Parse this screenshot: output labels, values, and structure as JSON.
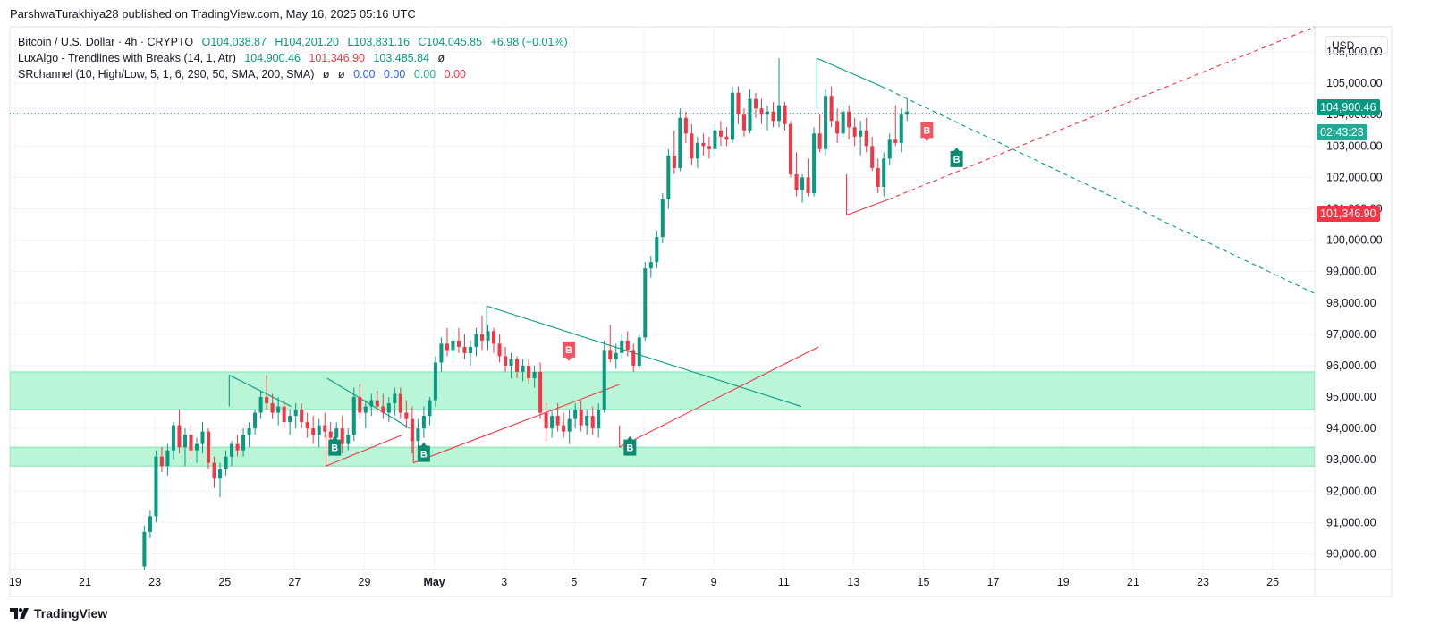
{
  "publish_line": "ParshwaTurakhiya28 published on TradingView.com, May 16, 2025 05:16 UTC",
  "legend": {
    "main": {
      "title": "Bitcoin / U.S. Dollar · 4h · CRYPTO",
      "open": "O104,038.87",
      "high": "H104,201.20",
      "low": "L103,831.16",
      "close": "C104,045.85",
      "change": "+6.98 (+0.01%)"
    },
    "luxalgo": {
      "name": "LuxAlgo - Trendlines with Breaks (14, 1, Atr)",
      "v1": "104,900.46",
      "v2": "101,346.90",
      "v3": "103,485.84",
      "v4": "ø"
    },
    "srchannel": {
      "name": "SRchannel (10, High/Low, 5, 1, 6, 290, 50, SMA, 200, SMA)",
      "v1": "ø",
      "v2": "ø",
      "v3": "0.00",
      "v4": "0.00",
      "v5": "0.00",
      "v6": "0.00"
    }
  },
  "currency": "USD",
  "brand": "TradingView",
  "price_tags": {
    "upper": "104,900.46",
    "countdown": "02:43:23",
    "lower": "101,346.90"
  },
  "colors": {
    "up": "#089981",
    "down": "#f23645",
    "zone": "#b9f6d7",
    "zone_border": "#7be3ad",
    "upper_trend": "#089981",
    "lower_trend": "#f23645"
  },
  "chart_data": {
    "type": "candlestick",
    "title": "Bitcoin / U.S. Dollar · 4h · CRYPTO",
    "ylim": [
      89500,
      106800
    ],
    "y_ticks": [
      "90,000.00",
      "91,000.00",
      "92,000.00",
      "93,000.00",
      "94,000.00",
      "95,000.00",
      "96,000.00",
      "97,000.00",
      "98,000.00",
      "99,000.00",
      "100,000.00",
      "101,000.00",
      "102,000.00",
      "103,000.00",
      "104,000.00",
      "105,000.00",
      "106,000.00"
    ],
    "y_tick_values": [
      90000,
      91000,
      92000,
      93000,
      94000,
      95000,
      96000,
      97000,
      98000,
      99000,
      100000,
      101000,
      102000,
      103000,
      104000,
      105000,
      106000
    ],
    "x_ticks": [
      "19",
      "21",
      "23",
      "25",
      "27",
      "29",
      "May",
      "3",
      "5",
      "7",
      "9",
      "11",
      "13",
      "15",
      "17",
      "19",
      "21",
      "23",
      "25"
    ],
    "x_tick_day_index": [
      0,
      2,
      4,
      6,
      8,
      10,
      12,
      14,
      16,
      18,
      20,
      22,
      24,
      26,
      28,
      30,
      32,
      34,
      36
    ],
    "x_domain_days": [
      -0.15,
      37.2
    ],
    "candle_start_day": 3.7,
    "candles_per_day": 6,
    "candles": [
      [
        89600,
        90900,
        89500,
        90700
      ],
      [
        90700,
        91400,
        90500,
        91200
      ],
      [
        91200,
        93300,
        91000,
        93100
      ],
      [
        93100,
        93400,
        92600,
        92800
      ],
      [
        92800,
        93500,
        92500,
        93300
      ],
      [
        93300,
        94200,
        93000,
        94100
      ],
      [
        94100,
        94600,
        93200,
        93400
      ],
      [
        93400,
        94000,
        92800,
        93800
      ],
      [
        93800,
        94100,
        93000,
        93300
      ],
      [
        93300,
        93700,
        92900,
        93500
      ],
      [
        93500,
        94200,
        93200,
        93900
      ],
      [
        93900,
        94000,
        92700,
        92900
      ],
      [
        92900,
        93100,
        92100,
        92400
      ],
      [
        92400,
        92900,
        91800,
        92700
      ],
      [
        92700,
        93300,
        92500,
        93100
      ],
      [
        93100,
        93600,
        92800,
        93500
      ],
      [
        93500,
        93800,
        93100,
        93300
      ],
      [
        93300,
        94000,
        93100,
        93800
      ],
      [
        93800,
        94200,
        93400,
        94000
      ],
      [
        94000,
        94600,
        93800,
        94500
      ],
      [
        94500,
        95200,
        94300,
        95000
      ],
      [
        95000,
        95700,
        94600,
        94800
      ],
      [
        94800,
        95100,
        94300,
        94500
      ],
      [
        94500,
        95000,
        94100,
        94700
      ],
      [
        94700,
        94900,
        94000,
        94200
      ],
      [
        94200,
        94600,
        93800,
        94400
      ],
      [
        94400,
        94800,
        94000,
        94600
      ],
      [
        94600,
        94800,
        94000,
        94200
      ],
      [
        94200,
        94500,
        93700,
        94000
      ],
      [
        94000,
        94400,
        93500,
        93800
      ],
      [
        93800,
        94300,
        93400,
        94100
      ],
      [
        94100,
        94500,
        93700,
        93900
      ],
      [
        93900,
        94200,
        93300,
        93700
      ],
      [
        93700,
        94200,
        93400,
        94000
      ],
      [
        94000,
        94400,
        93200,
        93500
      ],
      [
        93500,
        94000,
        93300,
        93800
      ],
      [
        93800,
        95300,
        93600,
        95000
      ],
      [
        95000,
        95400,
        94300,
        94500
      ],
      [
        94500,
        94900,
        94000,
        94700
      ],
      [
        94700,
        95100,
        94400,
        94900
      ],
      [
        94900,
        95200,
        94500,
        94700
      ],
      [
        94700,
        95100,
        94300,
        94500
      ],
      [
        94500,
        95000,
        94200,
        94800
      ],
      [
        94800,
        95300,
        94400,
        95100
      ],
      [
        95100,
        95300,
        94300,
        94500
      ],
      [
        94500,
        94900,
        94000,
        94300
      ],
      [
        94300,
        94700,
        93200,
        93600
      ],
      [
        93600,
        94300,
        93400,
        94000
      ],
      [
        94000,
        94700,
        93700,
        94400
      ],
      [
        94400,
        95000,
        94100,
        94900
      ],
      [
        94900,
        96300,
        94700,
        96100
      ],
      [
        96100,
        96900,
        95800,
        96700
      ],
      [
        96700,
        97200,
        96300,
        96500
      ],
      [
        96500,
        97000,
        96200,
        96800
      ],
      [
        96800,
        97200,
        96400,
        96600
      ],
      [
        96600,
        97000,
        96200,
        96400
      ],
      [
        96400,
        96800,
        96000,
        96600
      ],
      [
        96600,
        97200,
        96300,
        97000
      ],
      [
        97000,
        97600,
        96500,
        96800
      ],
      [
        96800,
        97300,
        96500,
        97100
      ],
      [
        97100,
        97200,
        96400,
        96700
      ],
      [
        96700,
        97000,
        96100,
        96300
      ],
      [
        96300,
        96600,
        95800,
        96000
      ],
      [
        96000,
        96400,
        95600,
        96200
      ],
      [
        96200,
        96300,
        95600,
        95800
      ],
      [
        95800,
        96200,
        95500,
        96000
      ],
      [
        96000,
        96200,
        95400,
        95600
      ],
      [
        95600,
        96000,
        95300,
        95800
      ],
      [
        95800,
        96100,
        94300,
        94500
      ],
      [
        94500,
        94800,
        93600,
        94000
      ],
      [
        94000,
        94600,
        93700,
        94400
      ],
      [
        94400,
        94800,
        93900,
        94100
      ],
      [
        94100,
        94500,
        93700,
        93900
      ],
      [
        93900,
        94600,
        93500,
        94300
      ],
      [
        94300,
        94800,
        94000,
        94600
      ],
      [
        94600,
        94900,
        93900,
        94100
      ],
      [
        94100,
        94600,
        93800,
        94400
      ],
      [
        94400,
        94700,
        93800,
        94000
      ],
      [
        94000,
        94800,
        93700,
        94600
      ],
      [
        94600,
        96800,
        94500,
        96500
      ],
      [
        96500,
        97300,
        96100,
        96200
      ],
      [
        96200,
        96700,
        95900,
        96400
      ],
      [
        96400,
        97000,
        96200,
        96800
      ],
      [
        96800,
        97100,
        96300,
        96500
      ],
      [
        96500,
        96700,
        95800,
        96000
      ],
      [
        96000,
        97000,
        95900,
        96900
      ],
      [
        96900,
        99300,
        96800,
        99100
      ],
      [
        99100,
        99500,
        98800,
        99300
      ],
      [
        99300,
        100300,
        99100,
        100100
      ],
      [
        100100,
        101500,
        99900,
        101300
      ],
      [
        101300,
        102900,
        101000,
        102700
      ],
      [
        102700,
        103500,
        102100,
        102300
      ],
      [
        102300,
        104200,
        102200,
        103900
      ],
      [
        103900,
        104100,
        103100,
        103400
      ],
      [
        103400,
        103700,
        102400,
        102600
      ],
      [
        102600,
        103300,
        102300,
        103100
      ],
      [
        103100,
        103400,
        102700,
        103000
      ],
      [
        103000,
        103300,
        102600,
        102900
      ],
      [
        102900,
        103700,
        102700,
        103500
      ],
      [
        103500,
        103800,
        103000,
        103300
      ],
      [
        103300,
        103600,
        103000,
        103200
      ],
      [
        103200,
        104900,
        103100,
        104700
      ],
      [
        104700,
        104900,
        103700,
        104000
      ],
      [
        104000,
        104200,
        103300,
        103500
      ],
      [
        103500,
        104800,
        103400,
        104500
      ],
      [
        104500,
        104700,
        103900,
        104200
      ],
      [
        104200,
        104500,
        103700,
        104000
      ],
      [
        104000,
        104300,
        103500,
        104100
      ],
      [
        104100,
        104400,
        103600,
        103800
      ],
      [
        103800,
        105800,
        103600,
        104300
      ],
      [
        104300,
        104400,
        103500,
        103700
      ],
      [
        103700,
        103800,
        102000,
        102100
      ],
      [
        102100,
        102800,
        101400,
        101600
      ],
      [
        101600,
        102100,
        101200,
        102000
      ],
      [
        102000,
        102600,
        101400,
        101500
      ],
      [
        101500,
        103600,
        101400,
        103400
      ],
      [
        103400,
        104000,
        102800,
        102900
      ],
      [
        102900,
        104800,
        102700,
        104600
      ],
      [
        104600,
        104900,
        103600,
        103800
      ],
      [
        103800,
        104200,
        103100,
        103400
      ],
      [
        103400,
        104300,
        103300,
        104100
      ],
      [
        104100,
        104300,
        103200,
        103600
      ],
      [
        103600,
        103900,
        103000,
        103300
      ],
      [
        103300,
        103800,
        102700,
        103500
      ],
      [
        103500,
        103900,
        102800,
        103000
      ],
      [
        103000,
        103300,
        102200,
        102300
      ],
      [
        102300,
        102600,
        101500,
        101700
      ],
      [
        101700,
        102800,
        101400,
        102600
      ],
      [
        102600,
        103400,
        102400,
        103200
      ],
      [
        103200,
        104300,
        103000,
        103100
      ],
      [
        103100,
        104200,
        102800,
        104000
      ],
      [
        104000,
        104500,
        103800,
        104100
      ]
    ],
    "sr_zones": [
      [
        94600,
        95800
      ],
      [
        92800,
        93400
      ]
    ],
    "trendlines": [
      {
        "color": "upper",
        "style": "solid",
        "points": [
          [
            6.13,
            95700
          ],
          [
            7.9,
            94700
          ]
        ]
      },
      {
        "color": "upper",
        "style": "solid",
        "points": [
          [
            8.93,
            95600
          ],
          [
            11.3,
            94000
          ]
        ]
      },
      {
        "color": "upper",
        "style": "solid",
        "points": [
          [
            13.5,
            97900
          ],
          [
            22.5,
            94700
          ]
        ]
      },
      {
        "color": "upper",
        "style": "solid",
        "points": [
          [
            22.95,
            105800
          ],
          [
            24.8,
            104900
          ]
        ]
      },
      {
        "color": "upper",
        "style": "dashed",
        "points": [
          [
            24.8,
            104900
          ],
          [
            37.2,
            98300
          ]
        ]
      },
      {
        "color": "lower",
        "style": "solid",
        "points": [
          [
            8.9,
            92800
          ],
          [
            11.1,
            93800
          ]
        ]
      },
      {
        "color": "lower",
        "style": "solid",
        "points": [
          [
            11.4,
            92900
          ],
          [
            17.3,
            95400
          ]
        ]
      },
      {
        "color": "lower",
        "style": "solid",
        "points": [
          [
            17.3,
            93400
          ],
          [
            23.0,
            96600
          ]
        ]
      },
      {
        "color": "lower",
        "style": "solid",
        "points": [
          [
            23.8,
            100800
          ],
          [
            25.0,
            101300
          ]
        ]
      },
      {
        "color": "lower",
        "style": "dashed",
        "points": [
          [
            25.0,
            101300
          ],
          [
            37.2,
            106800
          ]
        ]
      }
    ],
    "trendline_verticals": [
      {
        "color": "upper",
        "day": 6.13,
        "from": 95700,
        "to": 94700
      },
      {
        "color": "upper",
        "day": 13.5,
        "from": 97900,
        "to": 96900
      },
      {
        "color": "upper",
        "day": 22.95,
        "from": 105800,
        "to": 104200
      },
      {
        "color": "lower",
        "day": 8.9,
        "from": 92800,
        "to": 93800
      },
      {
        "color": "lower",
        "day": 11.4,
        "from": 92900,
        "to": 94300
      },
      {
        "color": "lower",
        "day": 17.3,
        "from": 93400,
        "to": 94100
      },
      {
        "color": "lower",
        "day": 23.8,
        "from": 100800,
        "to": 102100
      }
    ],
    "break_labels": [
      {
        "text": "B",
        "type": "up",
        "day": 9.15,
        "price": 93700
      },
      {
        "text": "B",
        "type": "up",
        "day": 11.7,
        "price": 93500
      },
      {
        "text": "B",
        "type": "down",
        "day": 15.85,
        "price": 96200
      },
      {
        "text": "B",
        "type": "up",
        "day": 17.6,
        "price": 93700
      },
      {
        "text": "B",
        "type": "down",
        "day": 26.1,
        "price": 103200
      },
      {
        "text": "B",
        "type": "up",
        "day": 26.95,
        "price": 102900
      }
    ],
    "last_price": 104045.85
  }
}
